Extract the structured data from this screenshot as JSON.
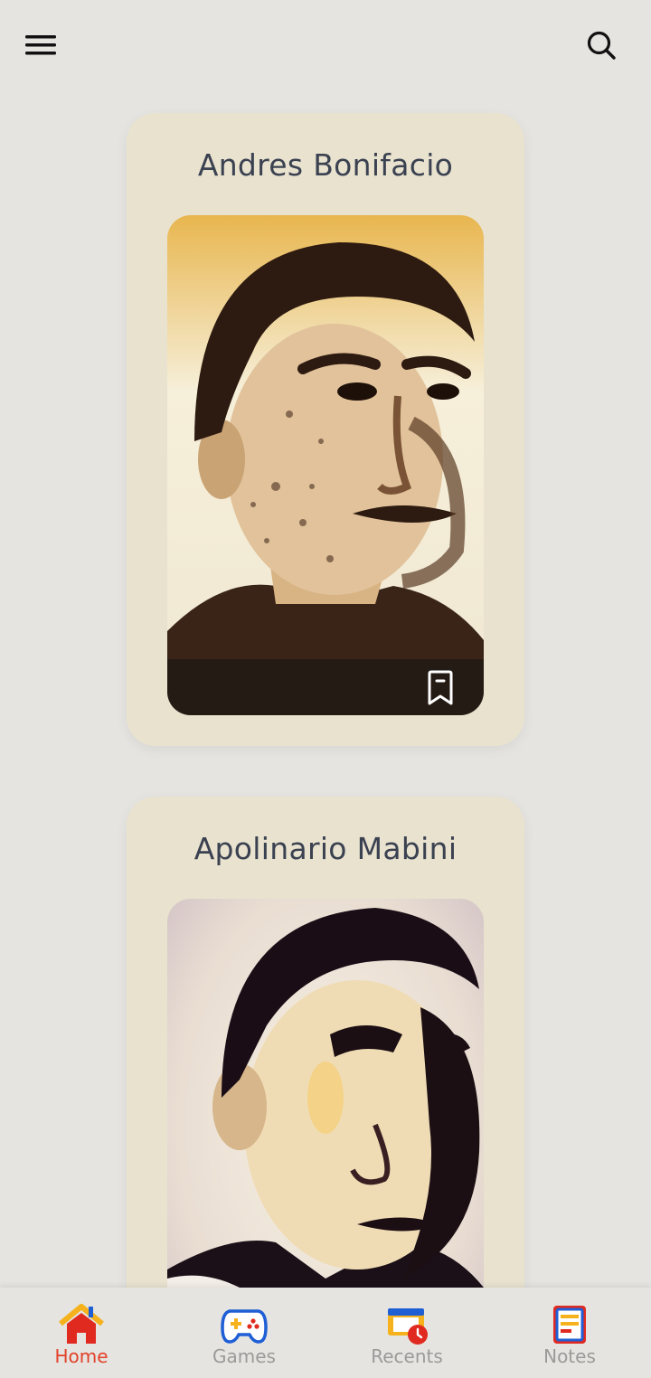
{
  "header": {
    "menu_icon": "hamburger-menu-icon",
    "search_icon": "search-icon"
  },
  "cards": [
    {
      "name": "Andres Bonifacio",
      "bookmark_icon": "bookmark-icon"
    },
    {
      "name": "Apolinario Mabini"
    }
  ],
  "bottom_nav": {
    "items": [
      {
        "label": "Home",
        "icon": "home-icon",
        "active": true
      },
      {
        "label": "Games",
        "icon": "gamepad-icon",
        "active": false
      },
      {
        "label": "Recents",
        "icon": "recents-icon",
        "active": false
      },
      {
        "label": "Notes",
        "icon": "notes-icon",
        "active": false
      }
    ]
  },
  "colors": {
    "background": "#e5e4e0",
    "card": "#e9e2cf",
    "title_text": "#3a4150",
    "active_nav": "#e2412a",
    "inactive_nav": "#9a9a9a"
  }
}
